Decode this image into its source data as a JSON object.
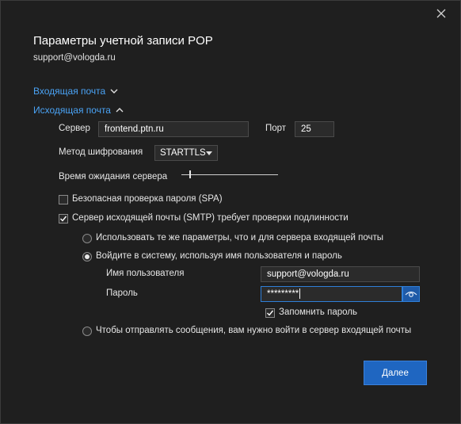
{
  "dialog": {
    "title": "Параметры учетной записи POP",
    "account": "support@vologda.ru"
  },
  "sections": {
    "incoming_label": "Входящая почта",
    "outgoing_label": "Исходящая почта"
  },
  "outgoing": {
    "server_label": "Сервер",
    "server_value": "frontend.ptn.ru",
    "port_label": "Порт",
    "port_value": "25",
    "encryption_label": "Метод шифрования",
    "encryption_value": "STARTTLS",
    "timeout_label": "Время ожидания сервера",
    "timeout_level": 0.08,
    "spa_label": "Безопасная проверка пароля (SPA)",
    "spa_checked": false,
    "auth_required_label": "Сервер исходящей почты (SMTP) требует проверки подлинности",
    "auth_required_checked": true,
    "auth_options": {
      "same_settings_label": "Использовать те же параметры, что и для сервера входящей почты",
      "login_label": "Войдите в систему, используя имя пользователя и пароль",
      "pop_before_smtp_label": "Чтобы отправлять сообщения, вам нужно войти в сервер входящей почты",
      "selected": "login"
    },
    "username_label": "Имя пользователя",
    "username_value": "support@vologda.ru",
    "password_label": "Пароль",
    "password_value": "*********",
    "remember_password_label": "Запомнить пароль",
    "remember_password_checked": true
  },
  "buttons": {
    "next_label": "Далее"
  },
  "icons": {
    "close": "close-icon",
    "chevron_down": "chevron-down-icon",
    "chevron_up": "chevron-up-icon",
    "checkmark": "checkmark-icon",
    "eye": "eye-icon"
  },
  "colors": {
    "background": "#1f1f1f",
    "link": "#4aa3f5",
    "primary_button": "#1f66c1",
    "focus_border": "#2f7fd8"
  }
}
